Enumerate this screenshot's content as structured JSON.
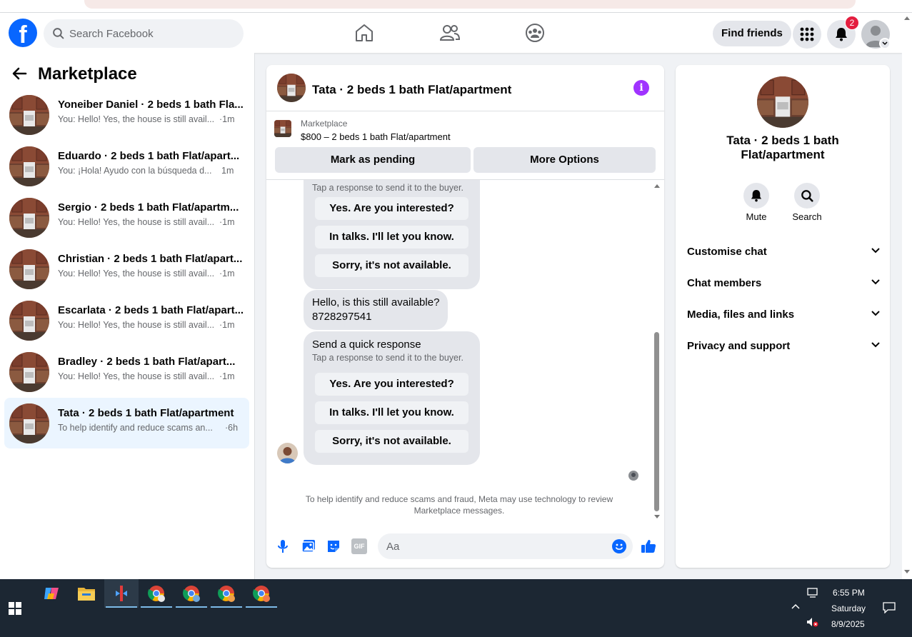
{
  "header": {
    "search_placeholder": "Search Facebook",
    "find_friends_label": "Find friends",
    "notification_count": "2"
  },
  "sidebar": {
    "title": "Marketplace",
    "conversations": [
      {
        "name": "Yoneiber Daniel · 2 beds 1 bath Fla...",
        "preview": "You: Hello! Yes, the house is still avail...",
        "time": "·1m"
      },
      {
        "name": "Eduardo · 2 beds 1 bath Flat/apart...",
        "preview": "You: ¡Hola! Ayudo con la búsqueda d...",
        "time": "1m"
      },
      {
        "name": "Sergio · 2 beds 1 bath Flat/apartm...",
        "preview": "You: Hello! Yes, the house is still avail...",
        "time": "·1m"
      },
      {
        "name": "Christian · 2 beds 1 bath Flat/apart...",
        "preview": "You: Hello! Yes, the house is still avail...",
        "time": "·1m"
      },
      {
        "name": "Escarlata · 2 beds 1 bath Flat/apart...",
        "preview": "You: Hello! Yes, the house is still avail...",
        "time": "·1m"
      },
      {
        "name": "Bradley · 2 beds 1 bath Flat/apart...",
        "preview": "You: Hello! Yes, the house is still avail...",
        "time": "·1m"
      },
      {
        "name": "Tata · 2 beds 1 bath Flat/apartment",
        "preview": "To help identify and reduce scams an...",
        "time": "·6h"
      }
    ]
  },
  "chat": {
    "title": "Tata · 2 beds 1 bath Flat/apartment",
    "listing_source": "Marketplace",
    "listing_title": "$800 – 2 beds 1 bath Flat/apartment",
    "mark_pending_label": "Mark as pending",
    "more_options_label": "More Options",
    "quick_response_1": {
      "subtitle": "Tap a response to send it to the buyer.",
      "options": [
        "Yes. Are you interested?",
        "In talks. I'll let you know.",
        "Sorry, it's not available."
      ]
    },
    "buyer_message_line1": "Hello, is this still available?",
    "buyer_message_line2": "8728297541",
    "quick_response_2": {
      "title": "Send a quick response",
      "subtitle": "Tap a response to send it to the buyer.",
      "options": [
        "Yes. Are you interested?",
        "In talks. I'll let you know.",
        "Sorry, it's not available."
      ]
    },
    "notice_line1": "To help identify and reduce scams and fraud, Meta may use technology to review",
    "notice_line2": "Marketplace messages.",
    "composer_placeholder": "Aa",
    "gif_label": "GIF"
  },
  "right_panel": {
    "title": "Tata · 2 beds 1 bath Flat/apartment",
    "mute_label": "Mute",
    "search_label": "Search",
    "sections": [
      "Customise chat",
      "Chat members",
      "Media, files and links",
      "Privacy and support"
    ]
  },
  "taskbar": {
    "time": "6:55 PM",
    "day": "Saturday",
    "date": "8/9/2025"
  },
  "colors": {
    "brand": "#0866ff",
    "accent_purple": "#a033ff",
    "badge_red": "#e41e3f",
    "active_conversation": "#ebf5ff"
  }
}
